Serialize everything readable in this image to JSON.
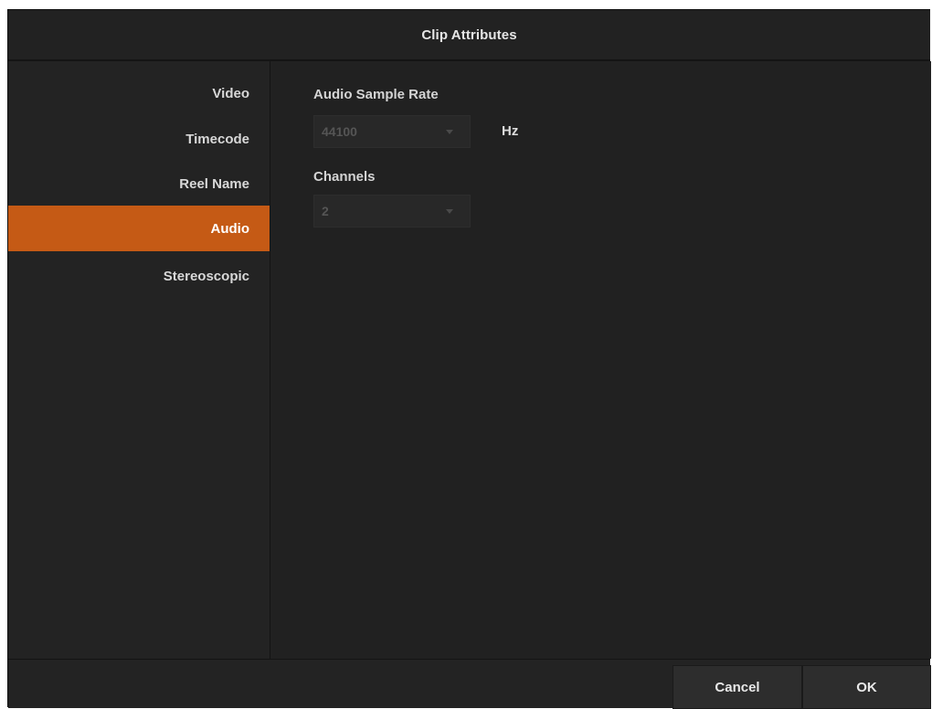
{
  "dialog": {
    "title": "Clip Attributes"
  },
  "sidebar": {
    "items": [
      {
        "label": "Video",
        "active": false
      },
      {
        "label": "Timecode",
        "active": false
      },
      {
        "label": "Reel Name",
        "active": false
      },
      {
        "label": "Audio",
        "active": true
      },
      {
        "label": "Stereoscopic",
        "active": false
      }
    ]
  },
  "audio": {
    "sample_rate_label": "Audio Sample Rate",
    "sample_rate_value": "44100",
    "sample_rate_unit": "Hz",
    "channels_label": "Channels",
    "channels_value": "2"
  },
  "footer": {
    "cancel_label": "Cancel",
    "ok_label": "OK"
  },
  "colors": {
    "accent": "#c55a15",
    "background": "#232323"
  }
}
